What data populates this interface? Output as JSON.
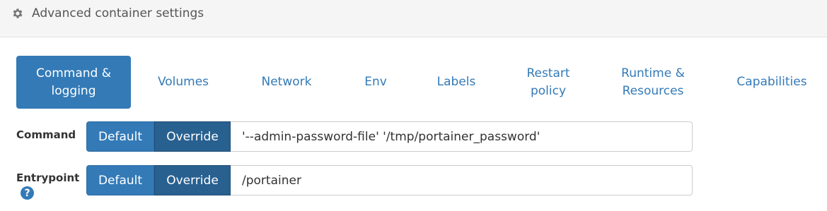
{
  "header": {
    "title": "Advanced container settings",
    "icon": "gear-icon"
  },
  "tabs": [
    {
      "label": "Command & logging",
      "active": true
    },
    {
      "label": "Volumes"
    },
    {
      "label": "Network"
    },
    {
      "label": "Env"
    },
    {
      "label": "Labels"
    },
    {
      "label": "Restart policy"
    },
    {
      "label": "Runtime & Resources"
    },
    {
      "label": "Capabilities"
    }
  ],
  "command": {
    "label": "Command",
    "default_label": "Default",
    "override_label": "Override",
    "value": "'--admin-password-file' '/tmp/portainer_password'"
  },
  "entrypoint": {
    "label": "Entrypoint",
    "default_label": "Default",
    "override_label": "Override",
    "value": "/portainer",
    "help_icon": "question-circle-icon"
  },
  "colors": {
    "accent": "#337ab7",
    "accent_dark": "#286090"
  }
}
